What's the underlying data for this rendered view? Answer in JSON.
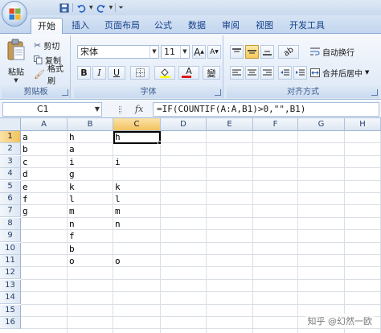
{
  "tabs": [
    "开始",
    "插入",
    "页面布局",
    "公式",
    "数据",
    "审阅",
    "视图",
    "开发工具"
  ],
  "clipboard": {
    "paste": "粘贴",
    "cut": "剪切",
    "copy": "复制",
    "format_painter": "格式刷",
    "group_label": "剪贴板"
  },
  "font": {
    "name": "宋体",
    "size": "11",
    "bold": "B",
    "italic": "I",
    "underline": "U",
    "grow": "A",
    "shrink": "A",
    "font_color": "A",
    "phonetic": "變",
    "group_label": "字体"
  },
  "alignment": {
    "wrap_text": "自动换行",
    "merge_center": "合并后居中",
    "group_label": "对齐方式"
  },
  "formula_bar": {
    "name_box": "C1",
    "fx": "fx",
    "formula": "=IF(COUNTIF(A:A,B1)>0,\"\",B1)"
  },
  "grid": {
    "columns": [
      "A",
      "B",
      "C",
      "D",
      "E",
      "F",
      "G",
      "H"
    ],
    "rows": [
      "1",
      "2",
      "3",
      "4",
      "5",
      "6",
      "7",
      "8",
      "9",
      "10",
      "11",
      "12",
      "13",
      "14",
      "15",
      "16"
    ],
    "selected_column": "C",
    "selected_row": "1",
    "colA": [
      "a",
      "b",
      "c",
      "d",
      "e",
      "f",
      "g"
    ],
    "colB": [
      "h",
      "a",
      "i",
      "g",
      "k",
      "l",
      "m",
      "n",
      "f",
      "b",
      "o"
    ],
    "colC": [
      "h",
      "",
      "i",
      "",
      "k",
      "l",
      "m",
      "n",
      "",
      "",
      "o"
    ]
  },
  "watermark": "知乎 @幻然一欧",
  "colors": {
    "tab_text": "#15428b",
    "selection": "#f2c35e",
    "font_color_bar": "#e01818",
    "highlight_bar": "#ffff00"
  }
}
